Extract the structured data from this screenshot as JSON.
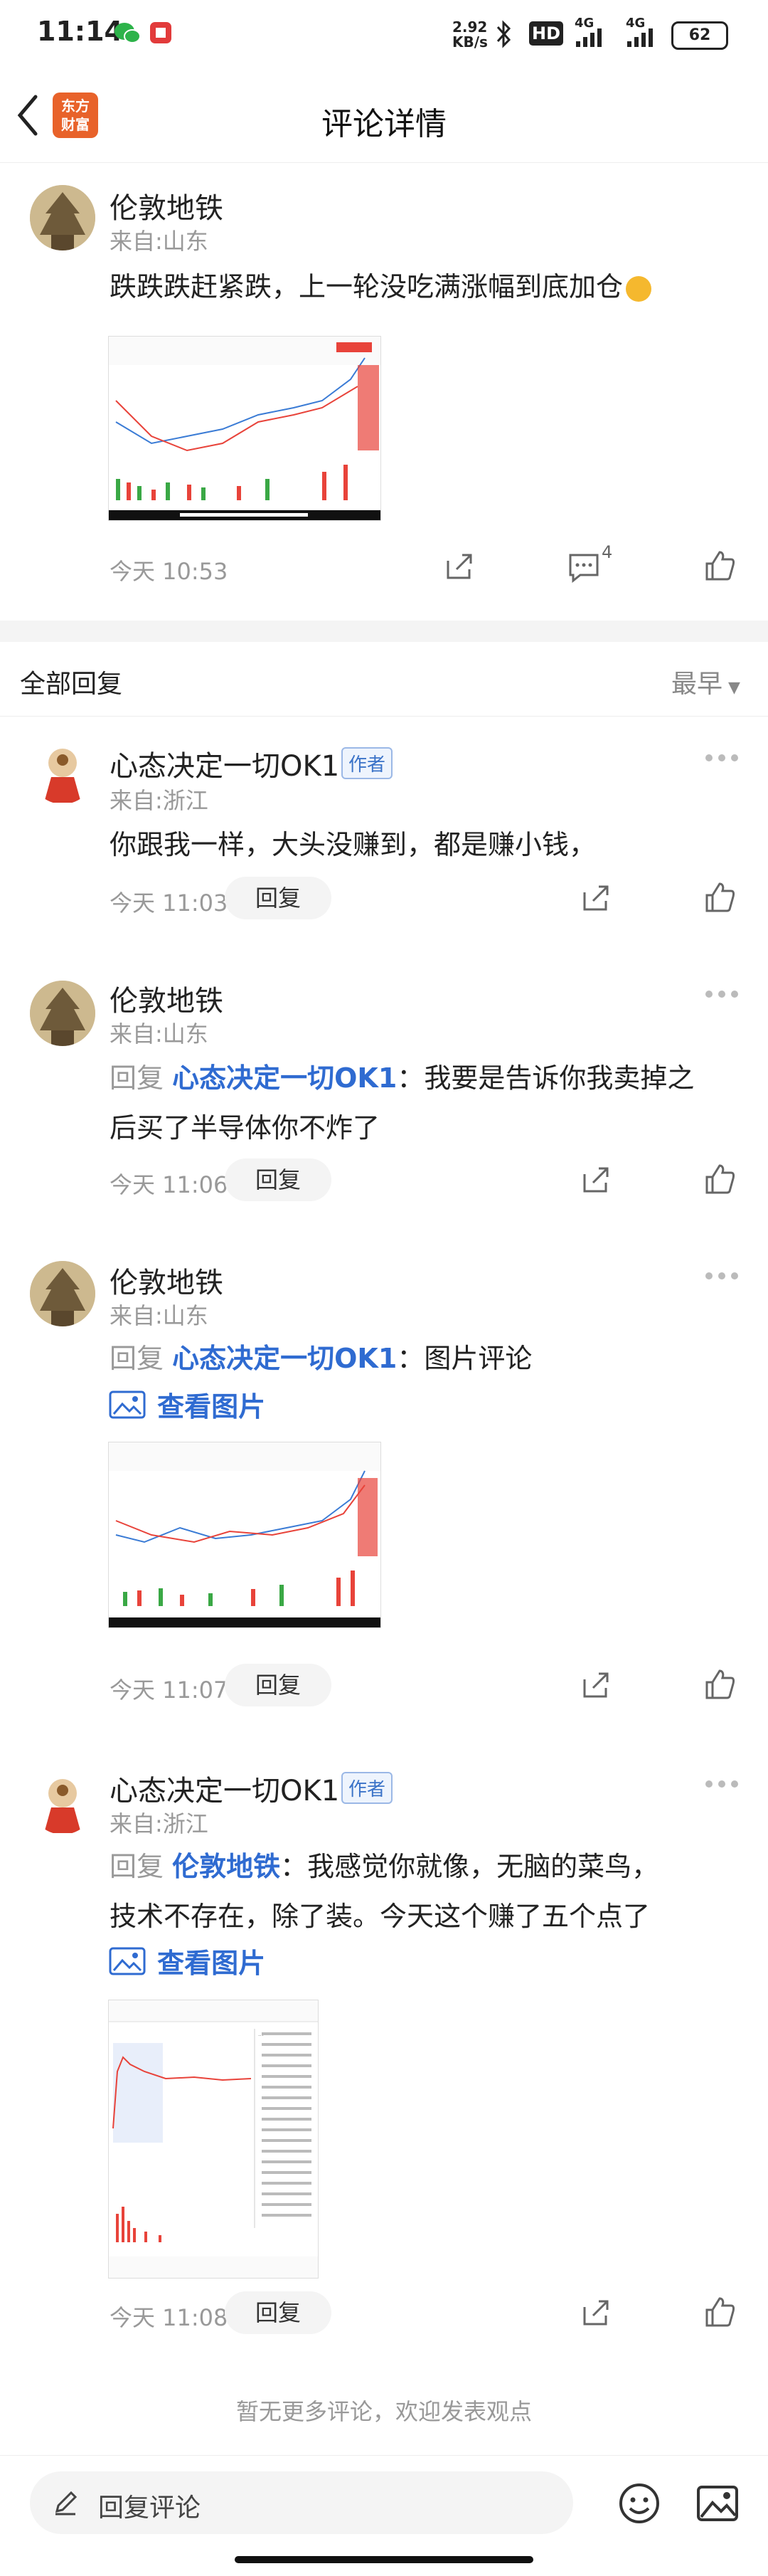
{
  "status": {
    "time": "11:14",
    "net_speed": "2.92",
    "net_unit": "KB/s",
    "hd": "HD",
    "sig1": "4G",
    "sig2": "4G",
    "battery": "62"
  },
  "header": {
    "title": "评论详情",
    "logo_top": "东方",
    "logo_bottom": "财富"
  },
  "post": {
    "author": "伦敦地铁",
    "from": "来自:山东",
    "content": "跌跌跌赶紧跌，上一轮没吃满涨幅到底加仓",
    "time": "今天 10:53",
    "comment_count": "4"
  },
  "replies_section": {
    "title": "全部回复",
    "sort": "最早"
  },
  "replies": [
    {
      "author": "心态决定一切OK1",
      "tag": "作者",
      "from": "来自:浙江",
      "content": "你跟我一样，大头没赚到，都是赚小钱，",
      "time": "今天 11:03",
      "reply_label": "回复"
    },
    {
      "author": "伦敦地铁",
      "from": "来自:山东",
      "reply_prefix": "回复",
      "reply_to": "心态决定一切OK1",
      "content_l1": "：我要是告诉你我卖掉之",
      "content_l2": "后买了半导体你不炸了",
      "time": "今天 11:06",
      "reply_label": "回复"
    },
    {
      "author": "伦敦地铁",
      "from": "来自:山东",
      "reply_prefix": "回复",
      "reply_to": "心态决定一切OK1",
      "content": "：图片评论",
      "view_image": "查看图片",
      "time": "今天 11:07",
      "reply_label": "回复"
    },
    {
      "author": "心态决定一切OK1",
      "tag": "作者",
      "from": "来自:浙江",
      "reply_prefix": "回复",
      "reply_to": "伦敦地铁",
      "content_l1": "：我感觉你就像，无脑的菜鸟，",
      "content_l2": "技术不存在，除了装。今天这个赚了五个点了",
      "view_image": "查看图片",
      "time": "今天 11:08",
      "reply_label": "回复"
    }
  ],
  "footer_note": "暂无更多评论，欢迎发表观点",
  "bottom_bar": {
    "input_placeholder": "回复评论"
  }
}
